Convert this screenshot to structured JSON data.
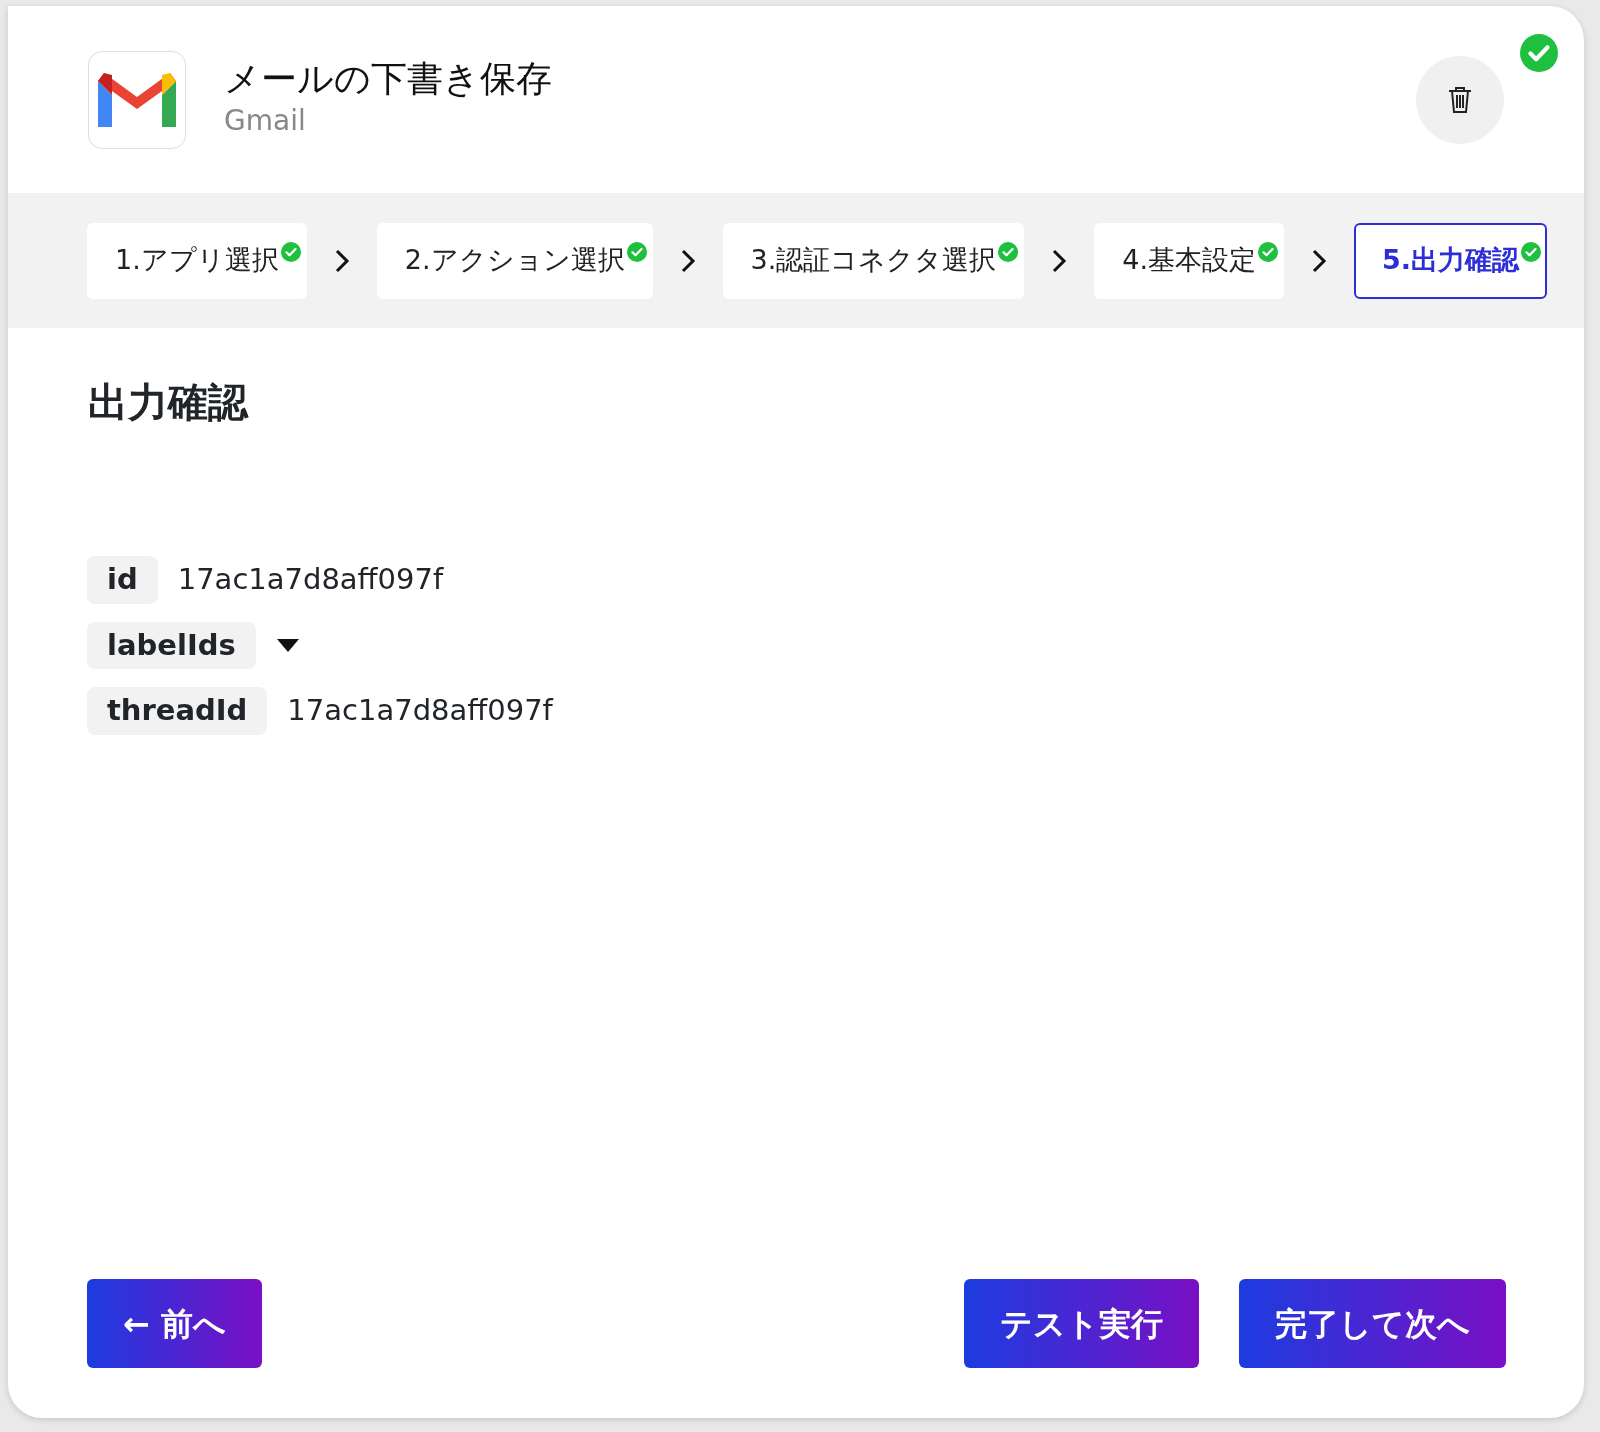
{
  "app": {
    "title": "メールの下書き保存",
    "subtitle": "Gmail",
    "completed": true
  },
  "steps": [
    {
      "label": "1.アプリ選択",
      "done": true,
      "selected": false
    },
    {
      "label": "2.アクション選択",
      "done": true,
      "selected": false
    },
    {
      "label": "3.認証コネクタ選択",
      "done": true,
      "selected": false
    },
    {
      "label": "4.基本設定",
      "done": true,
      "selected": false
    },
    {
      "label": "5.出力確認",
      "done": true,
      "selected": true
    }
  ],
  "section_title": "出力確認",
  "fields": [
    {
      "key": "id",
      "kind": "value",
      "value": "17ac1a7d8aff097f"
    },
    {
      "key": "labelIds",
      "kind": "toggle",
      "expanded": false
    },
    {
      "key": "threadId",
      "kind": "value",
      "value": "17ac1a7d8aff097f"
    }
  ],
  "footer": {
    "back": "← 前へ",
    "actions": [
      "テスト実行",
      "完了して次へ"
    ]
  }
}
